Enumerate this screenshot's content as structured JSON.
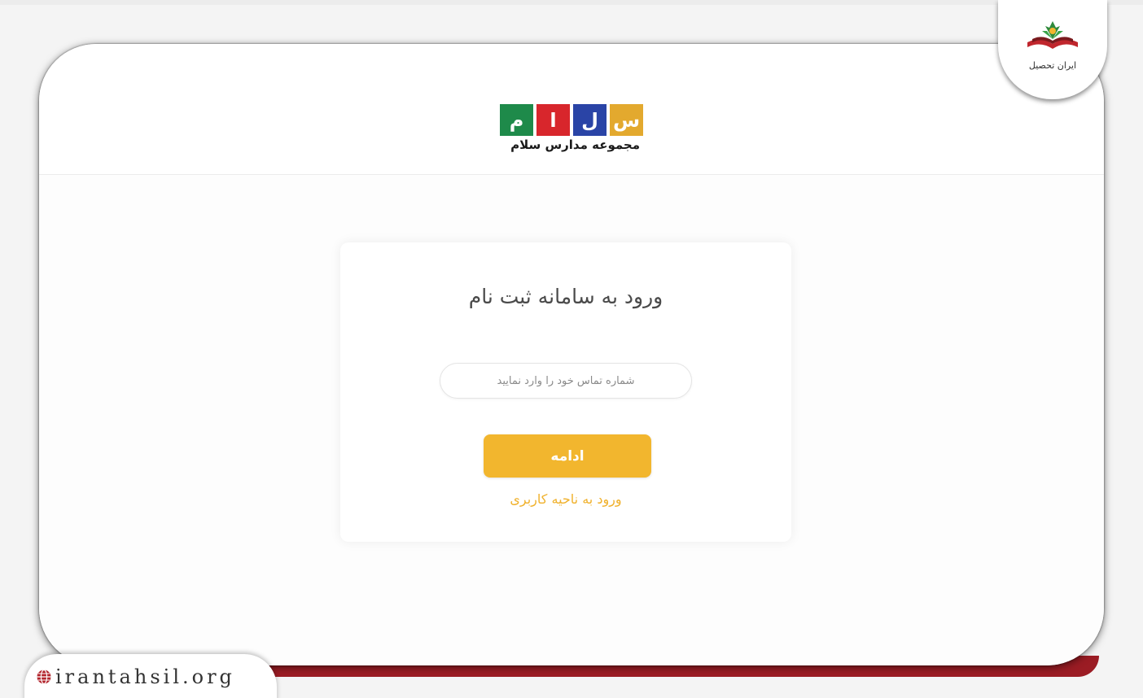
{
  "logo": {
    "tiles": [
      {
        "char": "س",
        "color": "#e3a92e"
      },
      {
        "char": "ل",
        "color": "#2a44a6"
      },
      {
        "char": "ا",
        "color": "#d8262c"
      },
      {
        "char": "م",
        "color": "#1e8a4a"
      }
    ],
    "caption": "مجموعه مدارس سلام"
  },
  "login": {
    "title": "ورود به سامانه ثبت نام",
    "phone_placeholder": "شماره تماس خود را وارد نمایید",
    "continue_label": "ادامه",
    "user_area_link": "ورود به ناحیه کاربری"
  },
  "badge": {
    "text": "ایران تحصیل"
  },
  "watermark": {
    "text": "irantahsil.org"
  },
  "colors": {
    "accent": "#f2b62e",
    "link": "#f0b12c",
    "bottom_bar": "#9b1c24"
  }
}
